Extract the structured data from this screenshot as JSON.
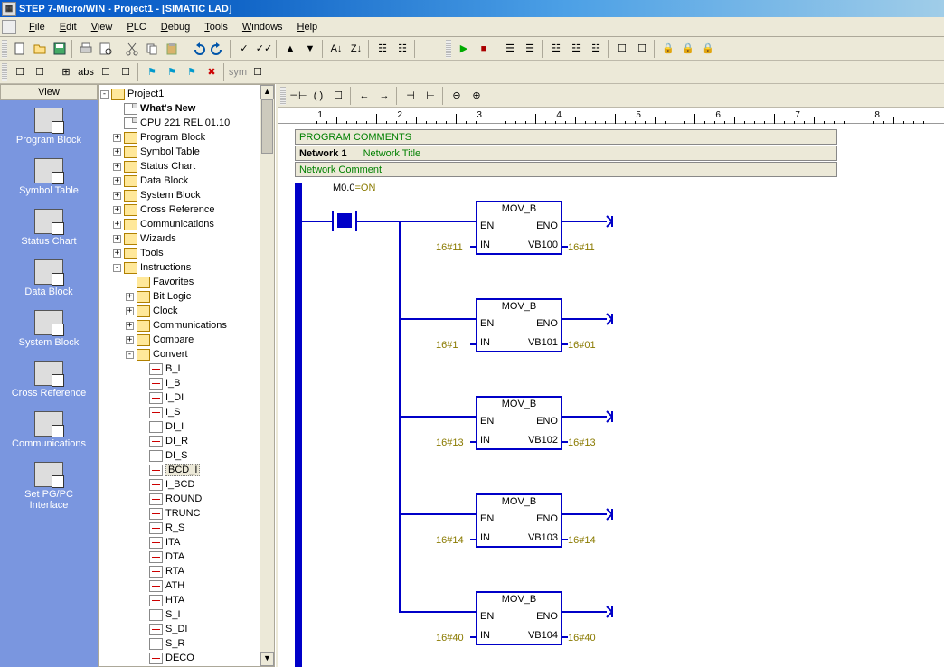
{
  "title": "STEP 7-Micro/WIN - Project1 - [SIMATIC LAD]",
  "menus": {
    "file": "File",
    "edit": "Edit",
    "view": "View",
    "plc": "PLC",
    "debug": "Debug",
    "tools": "Tools",
    "windows": "Windows",
    "help": "Help"
  },
  "viewPanel": {
    "header": "View",
    "items": [
      "Program Block",
      "Symbol Table",
      "Status Chart",
      "Data Block",
      "System Block",
      "Cross Reference",
      "Communications",
      "Set PG/PC\nInterface"
    ]
  },
  "tree": {
    "root": "Project1",
    "nodes": [
      {
        "label": "What's New",
        "bold": true,
        "icon": "help"
      },
      {
        "label": "CPU 221 REL 01.10",
        "icon": "cpu"
      },
      {
        "label": "Program Block",
        "icon": "folder",
        "exp": "+"
      },
      {
        "label": "Symbol Table",
        "icon": "folder",
        "exp": "+"
      },
      {
        "label": "Status Chart",
        "icon": "folder",
        "exp": "+"
      },
      {
        "label": "Data Block",
        "icon": "folder",
        "exp": "+"
      },
      {
        "label": "System Block",
        "icon": "folder",
        "exp": "+"
      },
      {
        "label": "Cross Reference",
        "icon": "folder",
        "exp": "+"
      },
      {
        "label": "Communications",
        "icon": "folder",
        "exp": "+"
      },
      {
        "label": "Wizards",
        "icon": "folder",
        "exp": "+"
      },
      {
        "label": "Tools",
        "icon": "folder",
        "exp": "+"
      }
    ],
    "instructions": "Instructions",
    "instChildren": [
      {
        "label": "Favorites",
        "icon": "folder"
      },
      {
        "label": "Bit Logic",
        "icon": "folder",
        "exp": "+"
      },
      {
        "label": "Clock",
        "icon": "folder",
        "exp": "+"
      },
      {
        "label": "Communications",
        "icon": "folder",
        "exp": "+"
      },
      {
        "label": "Compare",
        "icon": "folder",
        "exp": "+"
      }
    ],
    "convert": "Convert",
    "convertChildren": [
      "B_I",
      "I_B",
      "I_DI",
      "I_S",
      "DI_I",
      "DI_R",
      "DI_S",
      "BCD_I",
      "I_BCD",
      "ROUND",
      "TRUNC",
      "R_S",
      "ITA",
      "DTA",
      "RTA",
      "ATH",
      "HTA",
      "S_I",
      "S_DI",
      "S_R",
      "DECO"
    ]
  },
  "ladder": {
    "progComments": "PROGRAM COMMENTS",
    "network": "Network 1",
    "netTitle": "Network Title",
    "netComment": "Network Comment",
    "contact": {
      "address": "M0.0",
      "state": "=ON"
    },
    "blocks": [
      {
        "type": "MOV_B",
        "inVal": "16#11",
        "out": "VB100",
        "outVal": "16#11"
      },
      {
        "type": "MOV_B",
        "inVal": "16#1",
        "out": "VB101",
        "outVal": "16#01"
      },
      {
        "type": "MOV_B",
        "inVal": "16#13",
        "out": "VB102",
        "outVal": "16#13"
      },
      {
        "type": "MOV_B",
        "inVal": "16#14",
        "out": "VB103",
        "outVal": "16#14"
      },
      {
        "type": "MOV_B",
        "inVal": "16#40",
        "out": "VB104",
        "outVal": "16#40"
      }
    ],
    "pins": {
      "en": "EN",
      "eno": "ENO",
      "in": "IN"
    }
  },
  "ruler": [
    1,
    2,
    3,
    4,
    5,
    6,
    7,
    8
  ]
}
